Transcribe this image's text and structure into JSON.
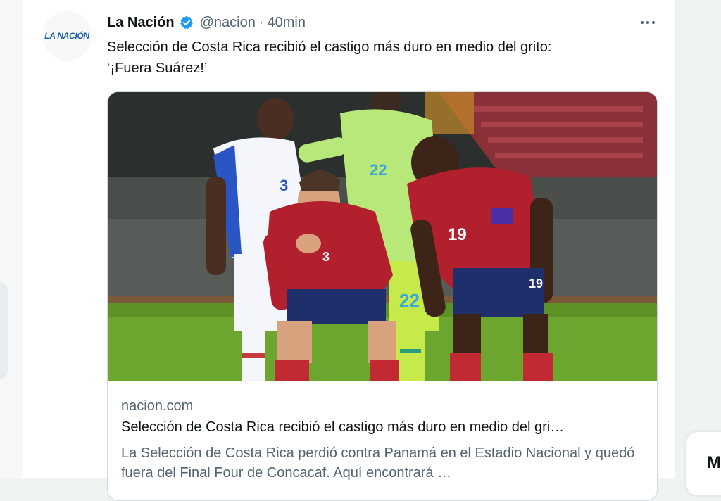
{
  "tweet": {
    "avatar_text": "LA NACIÓN",
    "author_name": "La Nación",
    "handle": "@nacion",
    "separator": "·",
    "time": "40min",
    "text_line1": "Selección de Costa Rica recibió el castigo más duro en medio del grito:",
    "text_line2": "‘¡Fuera Suárez!’",
    "icons": {
      "verified": "verified-badge-icon",
      "more": "more-options-icon"
    }
  },
  "card": {
    "domain": "nacion.com",
    "title": "Selección de Costa Rica recibió el castigo más duro en medio del gri…",
    "description": "La Selección de Costa Rica perdió contra Panamá en el Estadio Nacional y quedó fuera del Final Four de Concacaf. Aquí encontrará …",
    "image_alt": "football players photo",
    "jersey_numbers": [
      "3",
      "3",
      "22",
      "22",
      "19",
      "19"
    ]
  },
  "right_widget": {
    "letter": "M"
  },
  "colors": {
    "accent_blue": "#1d9bf0",
    "text_primary": "#0f1419",
    "text_secondary": "#536471",
    "costa_rica_red": "#b3202d",
    "panama_white": "#f4f6fb",
    "keeper_green": "#b9e87a"
  }
}
